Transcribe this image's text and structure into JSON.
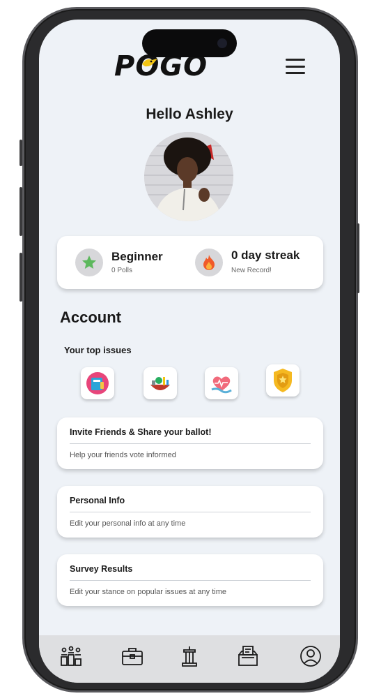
{
  "app": {
    "logo_text": "PŌGO",
    "colors": {
      "accent": "#f2c515",
      "background": "#eef2f7",
      "nav_bar": "#dedfe1"
    }
  },
  "header": {
    "menu_icon": "hamburger-menu-icon"
  },
  "greeting": "Hello Ashley",
  "stats": {
    "level": {
      "title": "Beginner",
      "subtitle": "0 Polls",
      "icon": "star-icon"
    },
    "streak": {
      "title": "0 day streak",
      "subtitle": "New Record!",
      "icon": "flame-icon"
    }
  },
  "account": {
    "heading": "Account",
    "top_issues_label": "Your top issues",
    "issues": [
      {
        "icon": "education-icon"
      },
      {
        "icon": "environment-icon"
      },
      {
        "icon": "healthcare-icon"
      },
      {
        "icon": "police-badge-icon"
      }
    ],
    "cards": [
      {
        "title": "Invite Friends & Share your ballot!",
        "subtitle": "Help your friends vote informed"
      },
      {
        "title": "Personal Info",
        "subtitle": "Edit your personal info at any time"
      },
      {
        "title": "Survey Results",
        "subtitle": "Edit your stance on popular issues at any time"
      }
    ]
  },
  "bottom_nav": [
    {
      "icon": "community-icon"
    },
    {
      "icon": "briefcase-icon"
    },
    {
      "icon": "podium-icon"
    },
    {
      "icon": "ballot-box-icon"
    },
    {
      "icon": "profile-icon"
    }
  ]
}
